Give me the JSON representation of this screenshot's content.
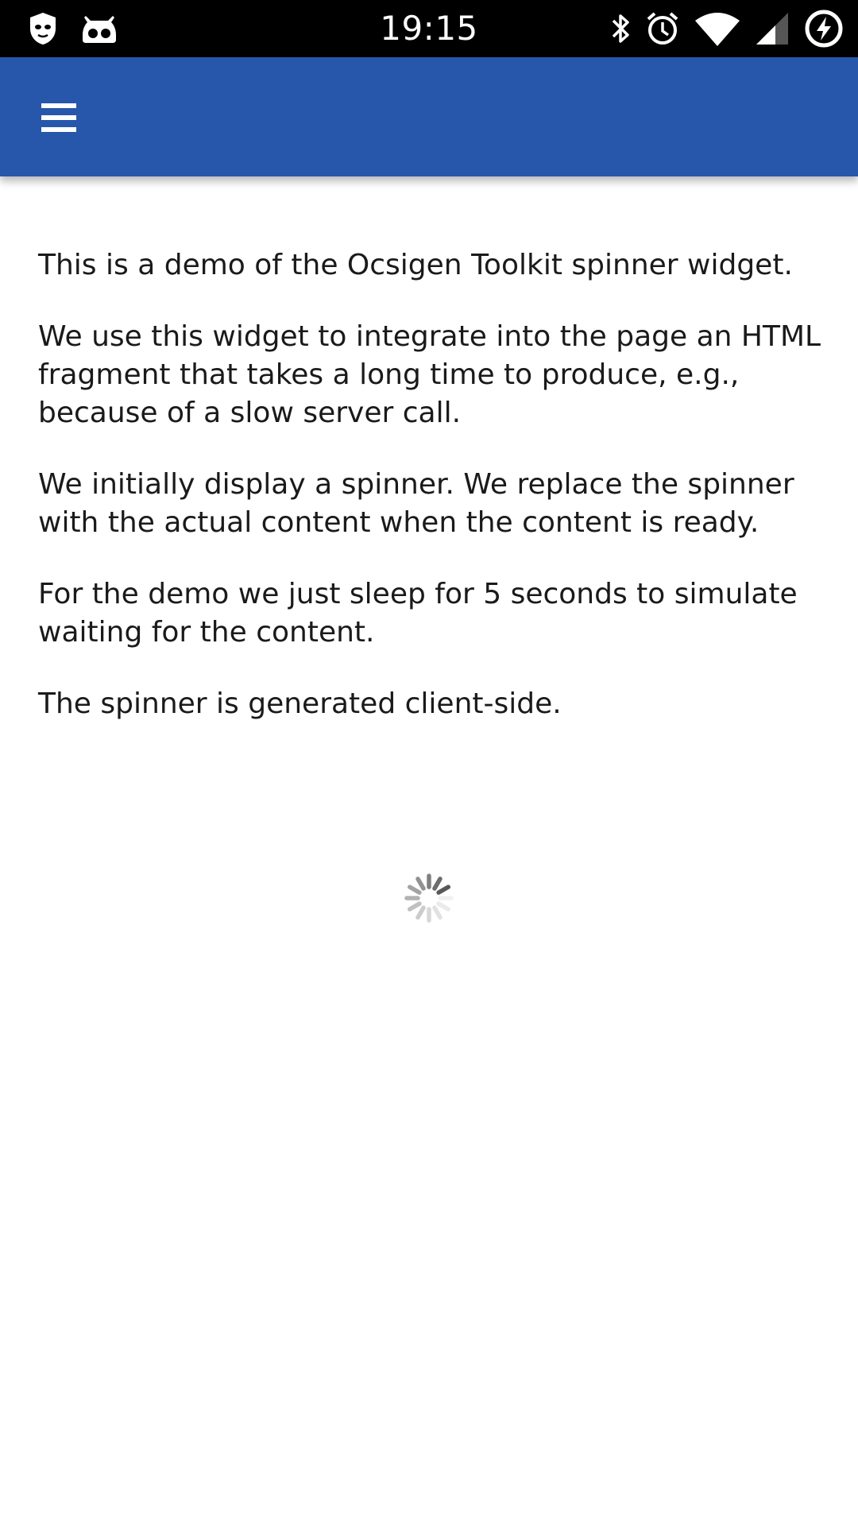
{
  "status_bar": {
    "time": "19:15",
    "left_icons": [
      "shield-cat-icon",
      "cyanogen-bot-icon"
    ],
    "right_icons": [
      "bluetooth-icon",
      "alarm-icon",
      "wifi-icon",
      "signal-icon",
      "battery-charging-icon"
    ]
  },
  "app_bar": {
    "color": "#2757aa",
    "menu_icon": "hamburger-menu-icon"
  },
  "content": {
    "paragraphs": [
      "This is a demo of the Ocsigen Toolkit spinner widget.",
      "We use this widget to integrate into the page an HTML fragment that takes a long time to produce, e.g., because of a slow server call.",
      "We initially display a spinner. We replace the spinner with the actual content when the content is ready.",
      "For the demo we just sleep for 5 seconds to simulate waiting for the content.",
      "The spinner is generated client-side."
    ],
    "spinner_icon": "loading-spinner-icon"
  }
}
